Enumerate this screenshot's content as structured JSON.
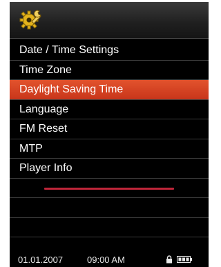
{
  "header": {
    "icon": "settings-wrench-gear-icon",
    "accent_color": "#e8b820"
  },
  "menu": {
    "items": [
      {
        "label": "Date / Time Settings",
        "selected": false
      },
      {
        "label": "Time Zone",
        "selected": false
      },
      {
        "label": "Daylight Saving Time",
        "selected": true
      },
      {
        "label": "Language",
        "selected": false
      },
      {
        "label": "FM Reset",
        "selected": false
      },
      {
        "label": "MTP",
        "selected": false
      },
      {
        "label": "Player Info",
        "selected": false
      }
    ],
    "selected_color": "#d8401f"
  },
  "status_bar": {
    "date": "01.01.2007",
    "time": "09:00 AM",
    "icons": [
      "lock-icon",
      "battery-icon"
    ]
  }
}
